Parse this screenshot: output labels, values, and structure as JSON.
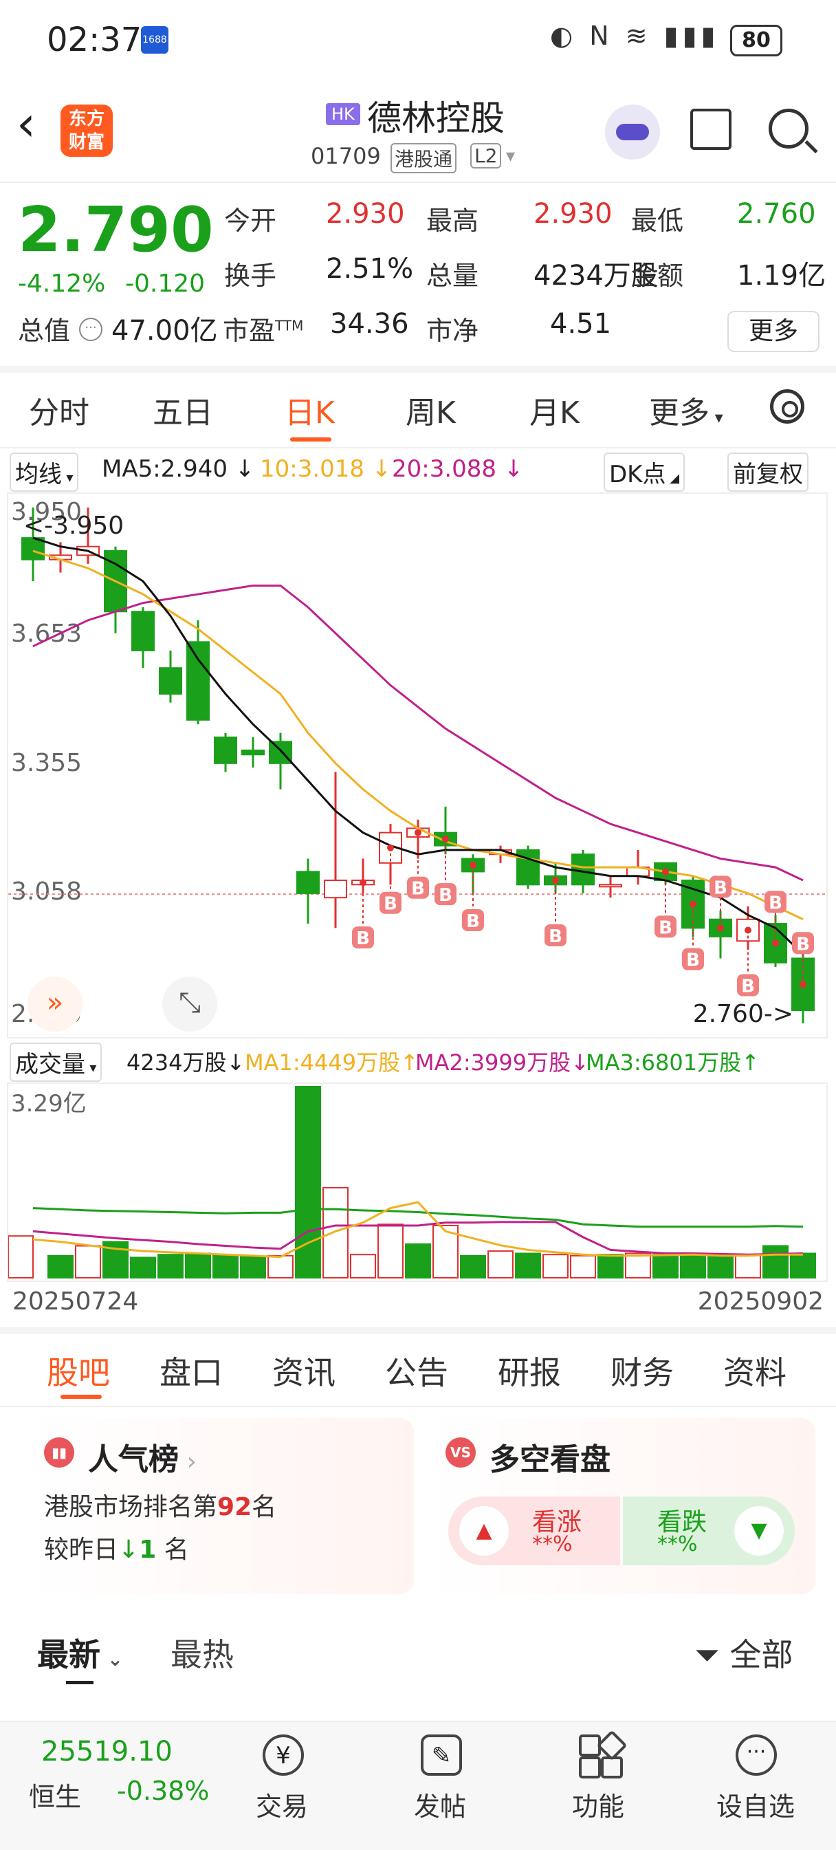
{
  "status_bar": {
    "time": "02:37",
    "app_badge": "1688",
    "icons": "◐ N ≋ ▮▮▮",
    "battery": "80"
  },
  "header": {
    "logo_text": "东方\n财富",
    "market_tag": "HK",
    "stock_name": "德林控股",
    "stock_code": "01709",
    "connect_tag": "港股通",
    "level_tag": "L2"
  },
  "quote": {
    "price": "2.790",
    "change_pct": "-4.12%",
    "change": "-0.120",
    "stats": [
      {
        "label": "今开",
        "value": "2.930",
        "color": "red"
      },
      {
        "label": "最高",
        "value": "2.930",
        "color": "red"
      },
      {
        "label": "最低",
        "value": "2.760",
        "color": "green"
      },
      {
        "label": "换手",
        "value": "2.51%",
        "color": "dark"
      },
      {
        "label": "总量",
        "value": "4234万股",
        "color": "dark"
      },
      {
        "label": "金额",
        "value": "1.19亿",
        "color": "dark"
      },
      {
        "label": "总值",
        "value": "47.00亿",
        "color": "dark"
      },
      {
        "label": "市盈",
        "sup": "TTM",
        "value": "34.36",
        "color": "dark"
      },
      {
        "label": "市净",
        "value": "4.51",
        "color": "dark"
      }
    ],
    "more_button": "更多"
  },
  "chart_tabs": [
    "分时",
    "五日",
    "日K",
    "周K",
    "月K",
    "更多"
  ],
  "active_chart_tab": "日K",
  "ma_bar": {
    "select": "均线",
    "ma5": "MA5:2.940",
    "ma10": "10:3.018",
    "ma20": "20:3.088",
    "dk_button": "DK点",
    "adjust_button": "前复权"
  },
  "kline": {
    "y_labels": [
      "3.950",
      "3.653",
      "3.355",
      "3.058",
      "2.760"
    ],
    "high_marker": "3.950",
    "low_marker": "2.760",
    "ref_price_line": 3.058
  },
  "volume_bar": {
    "select": "成交量",
    "vol": "4234万股",
    "ma1": "MA1:4449万股",
    "ma2": "MA2:3999万股",
    "ma3": "MA3:6801万股",
    "y_top": "3.29亿"
  },
  "chart_data": {
    "type": "candlestick",
    "x_range": [
      "20250724",
      "20250902"
    ],
    "ylim": [
      2.76,
      3.95
    ],
    "candles": [
      {
        "o": 3.88,
        "c": 3.83,
        "h": 3.95,
        "l": 3.78
      },
      {
        "o": 3.83,
        "c": 3.84,
        "h": 3.87,
        "l": 3.8
      },
      {
        "o": 3.84,
        "c": 3.86,
        "h": 3.95,
        "l": 3.82
      },
      {
        "o": 3.85,
        "c": 3.71,
        "h": 3.86,
        "l": 3.66
      },
      {
        "o": 3.71,
        "c": 3.62,
        "h": 3.72,
        "l": 3.58
      },
      {
        "o": 3.58,
        "c": 3.52,
        "h": 3.62,
        "l": 3.5
      },
      {
        "o": 3.64,
        "c": 3.46,
        "h": 3.69,
        "l": 3.45
      },
      {
        "o": 3.42,
        "c": 3.36,
        "h": 3.43,
        "l": 3.34
      },
      {
        "o": 3.39,
        "c": 3.38,
        "h": 3.42,
        "l": 3.35
      },
      {
        "o": 3.41,
        "c": 3.36,
        "h": 3.43,
        "l": 3.3
      },
      {
        "o": 3.11,
        "c": 3.06,
        "h": 3.14,
        "l": 2.99
      },
      {
        "o": 3.05,
        "c": 3.09,
        "h": 3.34,
        "l": 2.98
      },
      {
        "o": 3.08,
        "c": 3.09,
        "h": 3.14,
        "l": 3.06
      },
      {
        "o": 3.13,
        "c": 3.2,
        "h": 3.22,
        "l": 3.08
      },
      {
        "o": 3.19,
        "c": 3.21,
        "h": 3.23,
        "l": 3.14
      },
      {
        "o": 3.2,
        "c": 3.17,
        "h": 3.26,
        "l": 3.15
      },
      {
        "o": 3.14,
        "c": 3.11,
        "h": 3.15,
        "l": 3.06
      },
      {
        "o": 3.15,
        "c": 3.16,
        "h": 3.17,
        "l": 3.13
      },
      {
        "o": 3.16,
        "c": 3.08,
        "h": 3.17,
        "l": 3.07
      },
      {
        "o": 3.1,
        "c": 3.08,
        "h": 3.13,
        "l": 3.06
      },
      {
        "o": 3.15,
        "c": 3.08,
        "h": 3.16,
        "l": 3.06
      },
      {
        "o": 3.08,
        "c": 3.08,
        "h": 3.1,
        "l": 3.05
      },
      {
        "o": 3.1,
        "c": 3.12,
        "h": 3.16,
        "l": 3.08
      },
      {
        "o": 3.13,
        "c": 3.09,
        "h": 3.13,
        "l": 3.08
      },
      {
        "o": 3.09,
        "c": 2.98,
        "h": 3.1,
        "l": 2.96
      },
      {
        "o": 3.0,
        "c": 2.96,
        "h": 3.02,
        "l": 2.91
      },
      {
        "o": 2.95,
        "c": 3.0,
        "h": 3.03,
        "l": 2.93
      },
      {
        "o": 2.99,
        "c": 2.9,
        "h": 3.01,
        "l": 2.89
      },
      {
        "o": 2.91,
        "c": 2.79,
        "h": 2.93,
        "l": 2.76
      }
    ],
    "ma5": [
      3.88,
      3.86,
      3.85,
      3.82,
      3.78,
      3.7,
      3.6,
      3.52,
      3.45,
      3.39,
      3.32,
      3.25,
      3.2,
      3.17,
      3.15,
      3.16,
      3.16,
      3.16,
      3.14,
      3.12,
      3.11,
      3.1,
      3.1,
      3.09,
      3.07,
      3.05,
      3.01,
      2.98,
      2.92
    ],
    "ma10": [
      3.85,
      3.83,
      3.81,
      3.78,
      3.75,
      3.71,
      3.67,
      3.62,
      3.57,
      3.52,
      3.43,
      3.36,
      3.3,
      3.25,
      3.21,
      3.18,
      3.16,
      3.15,
      3.14,
      3.13,
      3.12,
      3.12,
      3.12,
      3.11,
      3.1,
      3.08,
      3.06,
      3.03,
      3.0
    ],
    "ma20": [
      3.63,
      3.66,
      3.69,
      3.71,
      3.73,
      3.74,
      3.75,
      3.76,
      3.77,
      3.77,
      3.72,
      3.66,
      3.6,
      3.54,
      3.49,
      3.44,
      3.4,
      3.36,
      3.32,
      3.28,
      3.25,
      3.22,
      3.2,
      3.18,
      3.16,
      3.14,
      3.13,
      3.12,
      3.09
    ],
    "buy_markers": [
      {
        "i": 12,
        "up": false
      },
      {
        "i": 13,
        "up": false
      },
      {
        "i": 14,
        "up": false
      },
      {
        "i": 15,
        "up": false
      },
      {
        "i": 16,
        "up": false
      },
      {
        "i": 19,
        "up": false
      },
      {
        "i": 23,
        "up": false
      },
      {
        "i": 24,
        "up": false
      },
      {
        "i": 25,
        "up": true
      },
      {
        "i": 26,
        "up": false
      },
      {
        "i": 27,
        "up": true
      },
      {
        "i": 28,
        "up": true
      }
    ],
    "volume": {
      "ylim": [
        0,
        3.29
      ],
      "values": [
        0.72,
        0.38,
        0.55,
        0.62,
        0.35,
        0.4,
        0.42,
        0.38,
        0.36,
        0.38,
        3.29,
        1.55,
        0.4,
        0.92,
        0.58,
        0.9,
        0.38,
        0.46,
        0.42,
        0.4,
        0.38,
        0.4,
        0.42,
        0.4,
        0.38,
        0.36,
        0.4,
        0.55,
        0.42
      ],
      "up_days": [
        0,
        2,
        9,
        11,
        12,
        13,
        15,
        17,
        19,
        20,
        22,
        26
      ],
      "ma1": [
        0.66,
        0.62,
        0.56,
        0.5,
        0.46,
        0.44,
        0.42,
        0.4,
        0.38,
        0.36,
        0.6,
        0.8,
        0.95,
        1.2,
        1.3,
        0.8,
        0.68,
        0.56,
        0.48,
        0.44,
        0.4,
        0.38,
        0.38,
        0.39,
        0.4,
        0.38,
        0.38,
        0.4,
        0.4
      ],
      "ma2": [
        0.8,
        0.76,
        0.72,
        0.68,
        0.65,
        0.62,
        0.58,
        0.55,
        0.52,
        0.5,
        0.8,
        0.9,
        0.9,
        0.9,
        0.9,
        0.95,
        0.95,
        0.96,
        0.96,
        0.96,
        0.7,
        0.48,
        0.45,
        0.42,
        0.42,
        0.41,
        0.4,
        0.41,
        0.42
      ],
      "ma3": [
        1.2,
        1.18,
        1.16,
        1.15,
        1.14,
        1.13,
        1.12,
        1.11,
        1.12,
        1.12,
        1.18,
        1.18,
        1.16,
        1.15,
        1.13,
        1.1,
        1.08,
        1.05,
        1.02,
        1.0,
        0.92,
        0.9,
        0.88,
        0.88,
        0.88,
        0.88,
        0.88,
        0.89,
        0.88
      ]
    }
  },
  "dates": {
    "start": "20250724",
    "end": "20250902"
  },
  "bottom_tabs": [
    "股吧",
    "盘口",
    "资讯",
    "公告",
    "研报",
    "财务",
    "资料"
  ],
  "active_bottom_tab": "股吧",
  "popularity": {
    "title": "人气榜",
    "rank_prefix": "港股市场排名第",
    "rank": "92",
    "rank_suffix": "名",
    "change_prefix": "较昨日",
    "change_value": "1",
    "change_suffix": "名"
  },
  "bull_bear": {
    "title": "多空看盘",
    "badge": "VS",
    "bull_label": "看涨",
    "bull_pct": "**%",
    "bear_label": "看跌",
    "bear_pct": "**%"
  },
  "feed": {
    "tab_new": "最新",
    "tab_hot": "最热",
    "filter": "全部"
  },
  "bottom_bar": {
    "index_value": "25519.10",
    "index_name": "恒生",
    "index_change": "-0.38%",
    "items": [
      "交易",
      "发帖",
      "功能",
      "设自选"
    ]
  },
  "colors": {
    "up": "#e03030",
    "down": "#1aa01a",
    "accent": "#ff5a1f",
    "ma5": "#111111",
    "ma10": "#f0b020",
    "ma20": "#c0208a"
  }
}
